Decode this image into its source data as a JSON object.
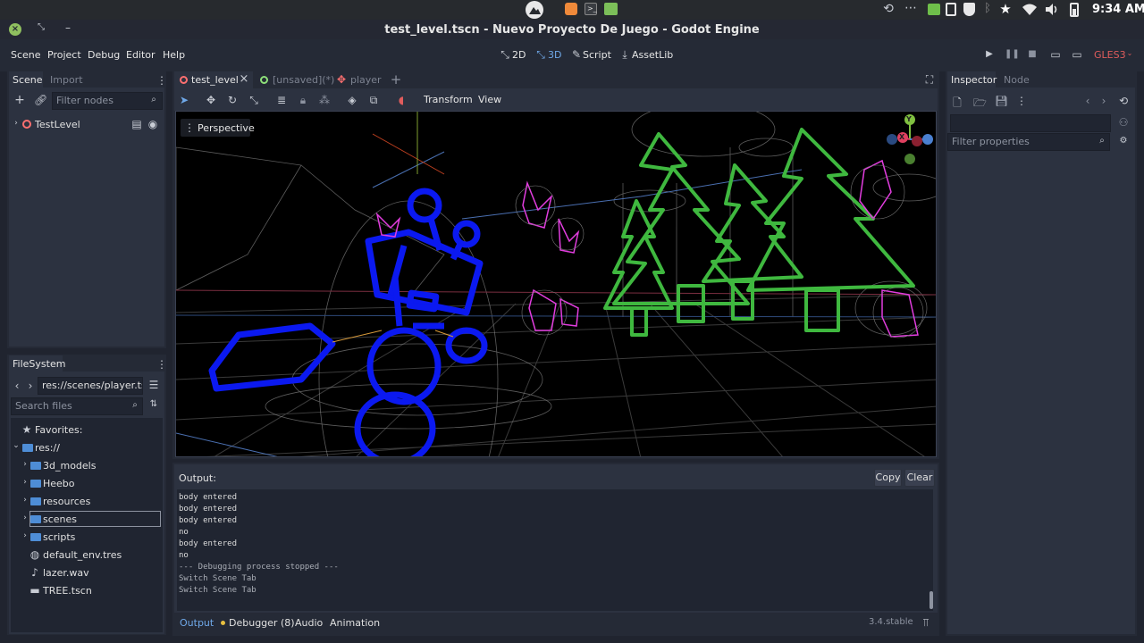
{
  "system": {
    "clock": "9:34 AM",
    "icons": [
      "app-launcher-icon",
      "firefox-icon",
      "terminal-icon",
      "files-icon",
      "history-icon",
      "more-icon",
      "battery-app-icon",
      "clipboard-icon",
      "shield-icon",
      "bluetooth-icon",
      "star-icon",
      "wifi-icon",
      "volume-icon",
      "battery-icon"
    ]
  },
  "window": {
    "title": "test_level.tscn - Nuevo Proyecto De Juego - Godot Engine",
    "controls": [
      "close-icon",
      "restore-icon",
      "minimize-icon"
    ]
  },
  "menu": {
    "items": [
      "Scene",
      "Project",
      "Debug",
      "Editor",
      "Help"
    ],
    "modes": [
      "2D",
      "3D",
      "Script",
      "AssetLib"
    ],
    "renderer": "GLES3"
  },
  "scene_dock": {
    "tabs": [
      "Scene",
      "Import"
    ],
    "filter_placeholder": "Filter nodes",
    "root_node": "TestLevel"
  },
  "filesystem": {
    "tab": "FileSystem",
    "path": "res://scenes/player.tsc",
    "search_placeholder": "Search files",
    "favorites": "Favorites:",
    "root": "res://",
    "folders": [
      "3d_models",
      "Heebo",
      "resources",
      "scenes",
      "scripts"
    ],
    "files": [
      "default_env.tres",
      "lazer.wav",
      "TREE.tscn"
    ]
  },
  "editor_tabs": [
    "test_level",
    "[unsaved](*)",
    "player"
  ],
  "viewport_toolbar": {
    "menus": [
      "Transform",
      "View"
    ],
    "perspective": "Perspective"
  },
  "gizmo": {
    "x": "X",
    "y": "Y"
  },
  "output": {
    "title": "Output:",
    "copy": "Copy",
    "clear": "Clear",
    "lines": [
      "body entered",
      "body entered",
      "body entered",
      "no",
      "body entered",
      "no",
      "--- Debugging process stopped ---",
      "Switch Scene Tab",
      "Switch Scene Tab"
    ]
  },
  "bottom_tabs": [
    "Output",
    "Debugger (8)",
    "Audio",
    "Animation"
  ],
  "version": "3.4.stable",
  "inspector": {
    "tabs": [
      "Inspector",
      "Node"
    ],
    "filter_placeholder": "Filter properties"
  },
  "colors": {
    "accent": "#6fa8e8",
    "scene_root": "#ff7070",
    "renderer": "#e05c5c",
    "player_mesh": "#0b19f0",
    "trees": "#3fb83f",
    "enemies": "#e23ddf"
  }
}
